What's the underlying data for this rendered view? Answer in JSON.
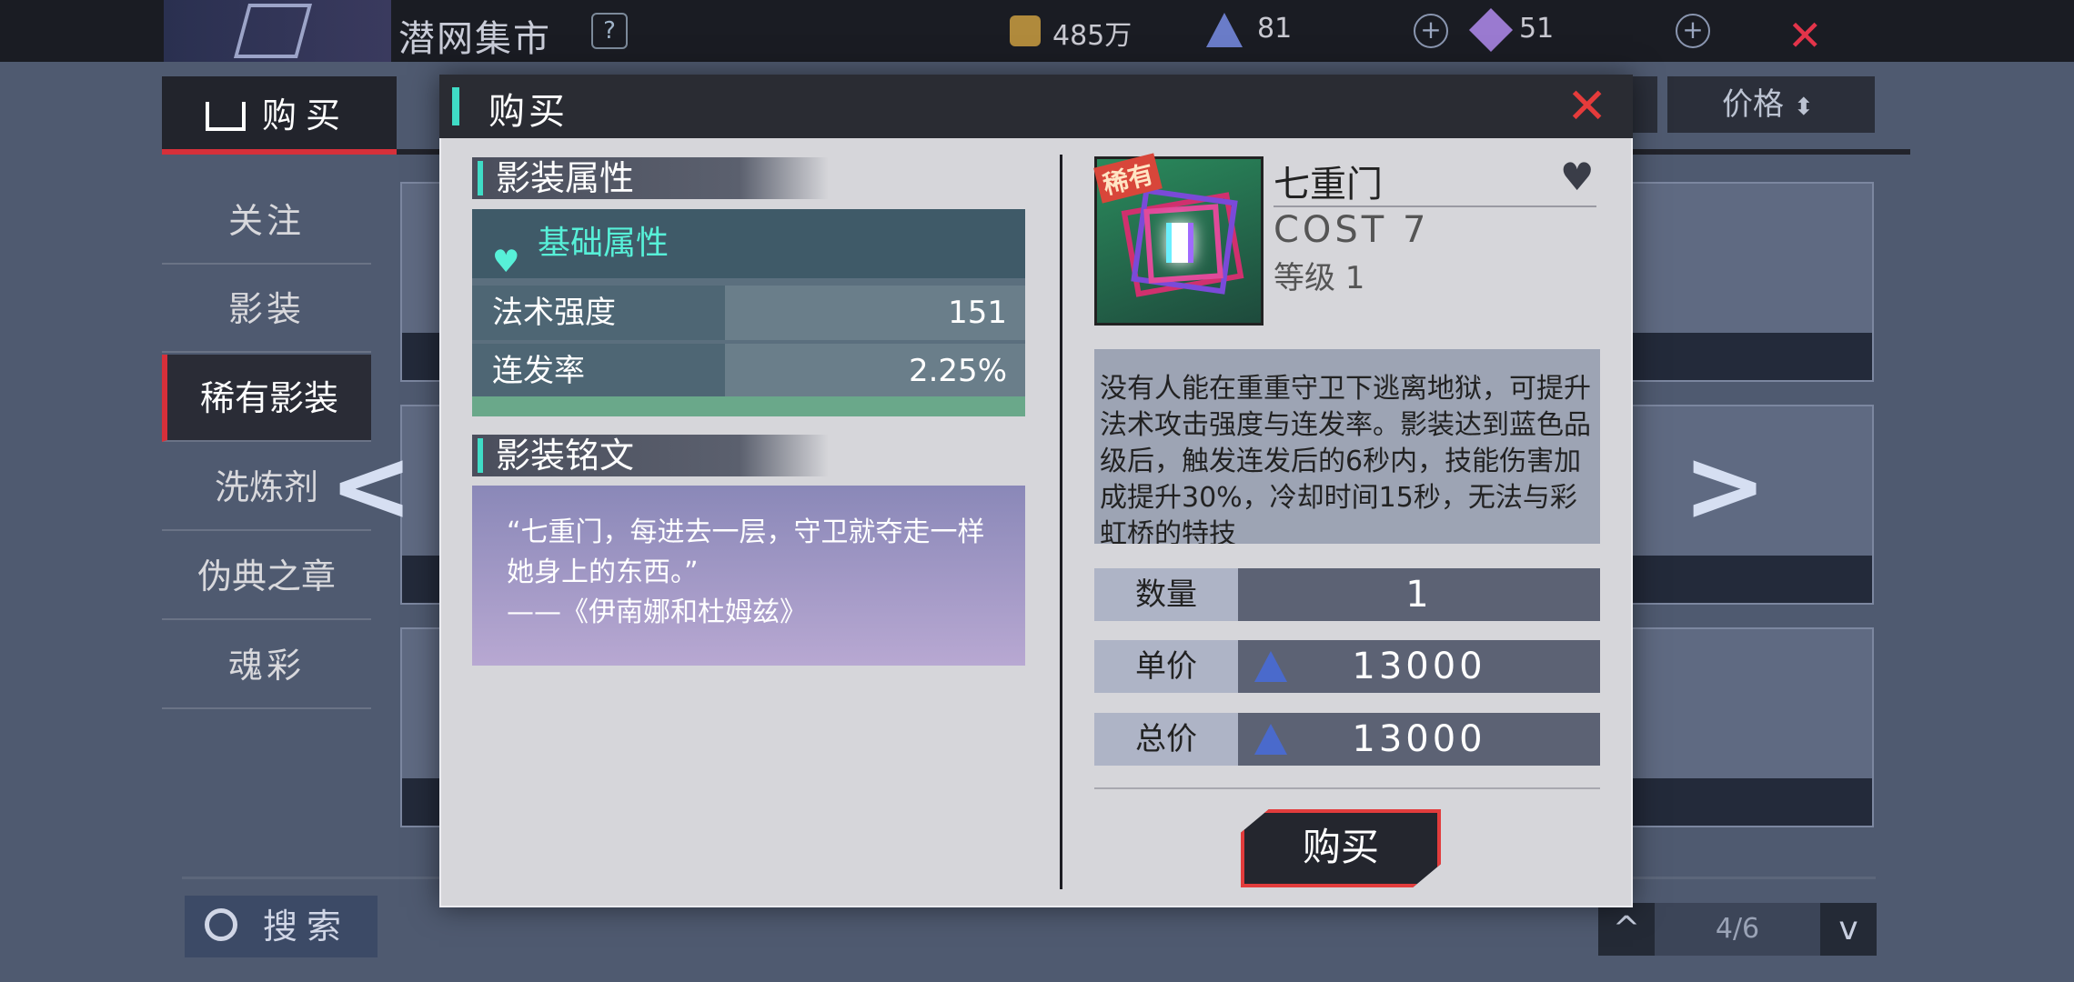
{
  "topbar": {
    "title": "潜网集市",
    "help": "?",
    "gold": "485万",
    "crystal": "81",
    "gem": "51",
    "plus": "+",
    "close": "✕"
  },
  "tabs": {
    "buy": "购买",
    "tab2": "",
    "tab3": ""
  },
  "filters": {
    "price": "价格",
    "sort_icon": "⬍"
  },
  "sidebar": {
    "items": [
      {
        "label": "关注"
      },
      {
        "label": "影装"
      },
      {
        "label": "稀有影装"
      },
      {
        "label": "洗炼剂"
      },
      {
        "label": "伪典之章"
      },
      {
        "label": "魂彩"
      }
    ]
  },
  "nav": {
    "left": "<",
    "right": ">"
  },
  "search": {
    "label": "搜索"
  },
  "pagination": {
    "text": "4/6",
    "up": "^",
    "down": "v"
  },
  "modal": {
    "title": "购买",
    "close": "✕",
    "attr_section": "影装属性",
    "basic_title": "基础属性",
    "attrs": [
      {
        "name": "法术强度",
        "value": "151"
      },
      {
        "name": "连发率",
        "value": "2.25%"
      }
    ],
    "inscription_section": "影装铭文",
    "quote": "“七重门，每进去一层，守卫就夺走一样她身上的东西。”",
    "quote_source": "——《伊南娜和杜姆兹》",
    "item": {
      "rare_badge": "稀有",
      "name": "七重门",
      "cost": "COST 7",
      "level": "等级  1"
    },
    "description": "没有人能在重重守卫下逃离地狱，可提升法术攻击强度与连发率。影装达到蓝色品级后，触发连发后的6秒内，技能伤害加成提升30%，冷却时间15秒，无法与彩虹桥的特技",
    "quantity_label": "数量",
    "quantity_value": "1",
    "unit_price_label": "单价",
    "unit_price_value": "13000",
    "total_price_label": "总价",
    "total_price_value": "13000",
    "buy_button": "购买"
  },
  "colors": {
    "accent": "#3fdcc6",
    "danger": "#e53b3b"
  }
}
